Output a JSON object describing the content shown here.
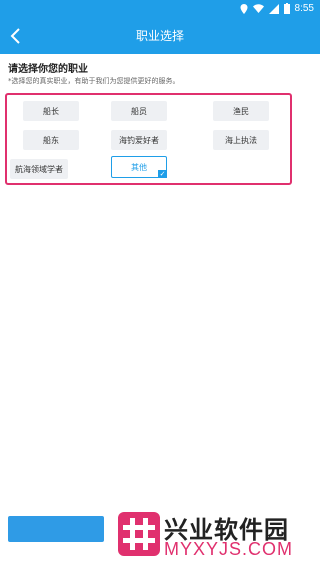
{
  "status_bar": {
    "time": "8:55",
    "icons": [
      "location-icon",
      "wifi-icon",
      "signal-icon",
      "battery-icon"
    ]
  },
  "app_bar": {
    "title": "职业选择",
    "back_icon": "back-chevron-icon"
  },
  "form": {
    "heading": "请选择你您的职业",
    "subtext": "*选择您的真实职业，有助于我们为您提供更好的服务。",
    "options": [
      {
        "label": "船长",
        "selected": false
      },
      {
        "label": "船员",
        "selected": false
      },
      {
        "label": "渔民",
        "selected": false
      },
      {
        "label": "船东",
        "selected": false
      },
      {
        "label": "海钓爱好者",
        "selected": false
      },
      {
        "label": "海上执法",
        "selected": false
      },
      {
        "label": "航海领域学者",
        "selected": false
      },
      {
        "label": "其他",
        "selected": true
      }
    ]
  },
  "watermark": {
    "title": "兴业软件园",
    "url": "MYXYJS.COM"
  },
  "colors": {
    "primary": "#1f9ee8",
    "highlight": "#e0306e",
    "option_bg": "#eef0f3"
  }
}
